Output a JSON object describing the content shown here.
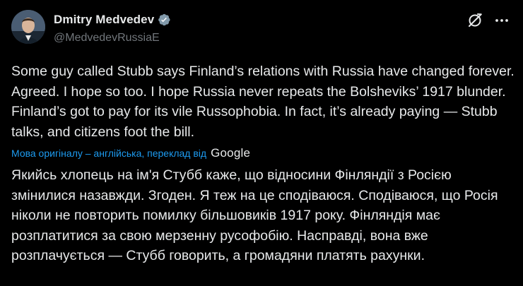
{
  "author": {
    "display_name": "Dmitry Medvedev",
    "handle": "@MedvedevRussiaE",
    "verified": true
  },
  "actions": {
    "grok_icon": "grok-icon",
    "more_icon": "more-icon"
  },
  "tweet": {
    "text": "Some guy called Stubb says Finland’s relations with Russia have changed forever. Agreed. I hope so too. I hope Russia never repeats the Bolsheviks’ 1917 blunder. Finland’s got to pay for its vile Russophobia. In fact, it’s already paying — Stubb talks, and citizens foot the bill."
  },
  "translation": {
    "link_label": "Мова оригіналу – англійська, переклад від",
    "provider": "Google",
    "text": "Якийсь хлопець на ім'я Стубб каже, що відносини Фінляндії з Росією змінилися назавжди. Згоден. Я теж на це сподіваюся. Сподіваюся, що Росія ніколи не повторить помилку більшовиків 1917 року. Фінляндія має розплатитися за свою мерзенну русофобію. Насправді, вона вже розплачується — Стубб говорить, а громадяни платять рахунки."
  },
  "colors": {
    "background": "#000000",
    "text": "#e7e9ea",
    "secondary_text": "#71767b",
    "link": "#1d9bf0",
    "verified_badge": "#829aab"
  }
}
